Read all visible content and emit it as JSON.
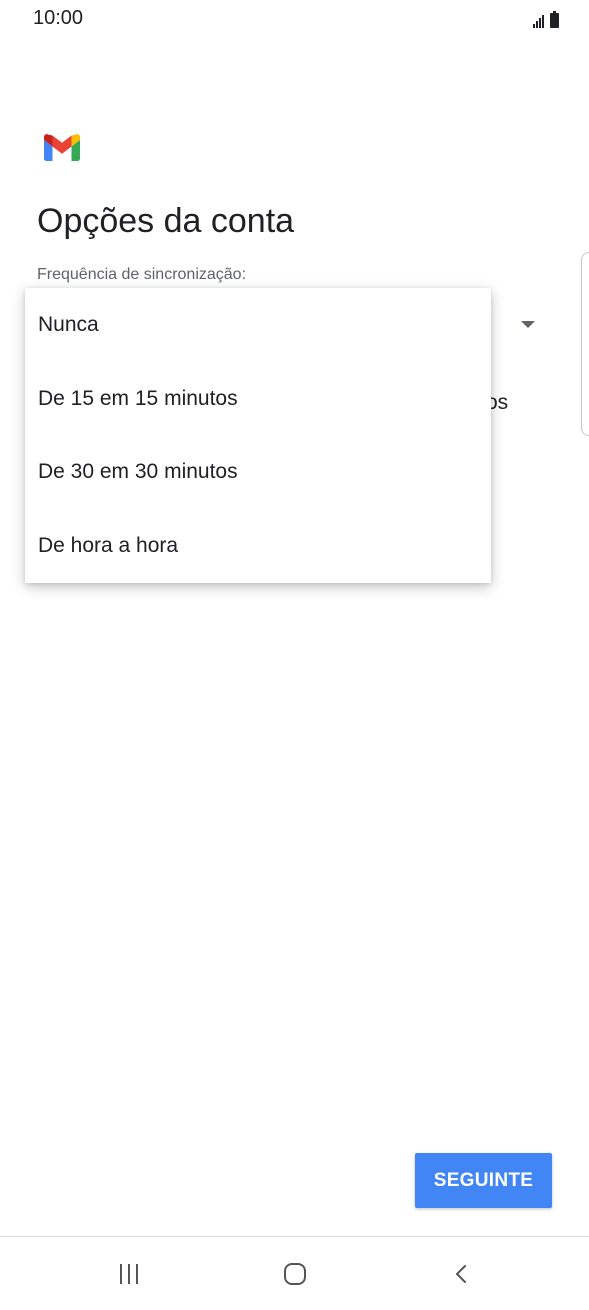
{
  "status_bar": {
    "time": "10:00",
    "icons": [
      "signal-icon",
      "battery-icon"
    ]
  },
  "app": {
    "logo": "gmail-logo-icon",
    "colors": {
      "gmail_red": "#EA4335",
      "gmail_blue": "#4285F4",
      "gmail_green": "#34A853",
      "gmail_yellow": "#FBBC04",
      "gmail_dark_red": "#C5221F"
    }
  },
  "page": {
    "title": "Opções da conta",
    "sync_label": "Frequência de sincronização:",
    "behind_text_fragment": "os"
  },
  "dropdown": {
    "options": [
      {
        "label": "Nunca"
      },
      {
        "label": "De 15 em 15 minutos"
      },
      {
        "label": "De 30 em 30 minutos"
      },
      {
        "label": "De hora a hora"
      }
    ]
  },
  "actions": {
    "next_label": "SEGUINTE",
    "accent": "#4285F4"
  },
  "nav_bar": {
    "icons": [
      "recent-apps-icon",
      "home-icon",
      "back-icon"
    ]
  }
}
